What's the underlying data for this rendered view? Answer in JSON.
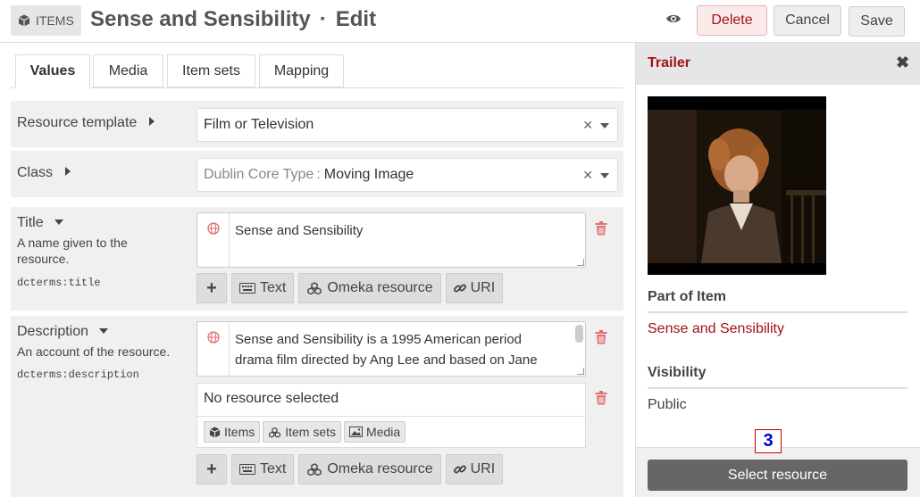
{
  "header": {
    "items_label": "ITEMS",
    "title": "Sense and Sensibility",
    "separator": "·",
    "mode": "Edit",
    "delete_label": "Delete",
    "cancel_label": "Cancel",
    "save_label": "Save"
  },
  "tabs": [
    {
      "label": "Values",
      "active": true
    },
    {
      "label": "Media",
      "active": false
    },
    {
      "label": "Item sets",
      "active": false
    },
    {
      "label": "Mapping",
      "active": false
    }
  ],
  "form": {
    "resource_template": {
      "label": "Resource template",
      "value": "Film or Television"
    },
    "class": {
      "label": "Class",
      "prefix": "Dublin Core Type",
      "separator": ":",
      "value": "Moving Image"
    },
    "title_prop": {
      "label": "Title",
      "desc_line1": "A name given to the",
      "desc_line2": "resource.",
      "term": "dcterms:title",
      "value": "Sense and Sensibility"
    },
    "description_prop": {
      "label": "Description",
      "desc": "An account of the resource.",
      "term": "dcterms:description",
      "value_line1": "Sense and Sensibility is a 1995 American period",
      "value_line2": "drama film directed by Ang Lee and based on Jane",
      "no_resource": "No resource selected",
      "res_items": "Items",
      "res_item_sets": "Item sets",
      "res_media": "Media"
    },
    "add_buttons": {
      "text": "Text",
      "omeka": "Omeka resource",
      "uri": "URI"
    }
  },
  "sidebar": {
    "title": "Trailer",
    "part_of_item_heading": "Part of Item",
    "part_of_item_link": "Sense and Sensibility",
    "visibility_heading": "Visibility",
    "visibility_value": "Public",
    "select_resource": "Select resource"
  },
  "marker": "3",
  "colors": {
    "accent": "#a3111a",
    "panel_bg": "#f0f0f0",
    "sidebar_button": "#666666"
  }
}
